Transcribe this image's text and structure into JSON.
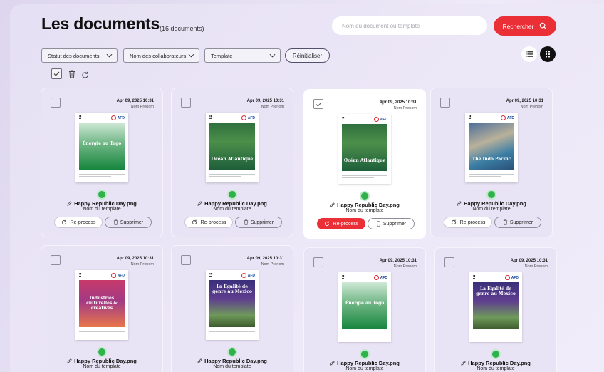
{
  "header": {
    "title": "Les documents",
    "count": "(16 documents)",
    "search_placeholder": "Nom du document ou template",
    "search_button": "Rechercher"
  },
  "filters": {
    "status": "Statut des documents",
    "collaborators": "Nom des collaborateurs",
    "template": "Template",
    "reset": "Réinitialiser"
  },
  "view": {
    "active": "grid"
  },
  "colors": {
    "accent": "#ea2f36",
    "status_ok": "#2fb14c"
  },
  "documents": [
    {
      "date": "Apr 09, 2025 10:31",
      "author": "Nom Prenom",
      "file": "Happy Republic Day.png",
      "template": "Nom du template",
      "thumb_title": "Énergie au Togo",
      "theme": "green",
      "selected": false,
      "reprocess": "Re-process",
      "delete": "Supprimer",
      "reprocess_active": false
    },
    {
      "date": "Apr 09, 2025 10:31",
      "author": "Nom Prenom",
      "file": "Happy Republic Day.png",
      "template": "Nom du template",
      "thumb_title": "Océan Atlantique",
      "theme": "forest",
      "selected": false,
      "reprocess": "Re-process",
      "delete": "Supprimer",
      "reprocess_active": false
    },
    {
      "date": "Apr 09, 2025 10:31",
      "author": "Nom Prenom",
      "file": "Happy Republic Day.png",
      "template": "Nom du template",
      "thumb_title": "Océan Atlantique",
      "theme": "forest",
      "selected": true,
      "reprocess": "Re-process",
      "delete": "Supprimer",
      "reprocess_active": true
    },
    {
      "date": "Apr 09, 2025 10:31",
      "author": "Nom Prenom",
      "file": "Happy Republic Day.png",
      "template": "Nom du template",
      "thumb_title": "The Indo Pacific",
      "theme": "ocean",
      "selected": false,
      "reprocess": "Re-process",
      "delete": "Supprimer",
      "reprocess_active": false
    },
    {
      "date": "Apr 09, 2025 10:31",
      "author": "Nom Prenom",
      "file": "Happy Republic Day.png",
      "template": "Nom du template",
      "thumb_title": "Industries culturelles & créatives",
      "theme": "sunset",
      "selected": false
    },
    {
      "date": "Apr 09, 2025 10:31",
      "author": "Nom Prenom",
      "file": "Happy Republic Day.png",
      "template": "Nom du template",
      "thumb_title": "La Égalité de genre au Mexico",
      "theme": "purple",
      "selected": false
    },
    {
      "date": "Apr 09, 2025 10:31",
      "author": "Nom Prenom",
      "file": "Happy Republic Day.png",
      "template": "Nom du template",
      "thumb_title": "Énergie au Togo",
      "theme": "green",
      "selected": false
    },
    {
      "date": "Apr 09, 2025 10:31",
      "author": "Nom Prenom",
      "file": "Happy Republic Day.png",
      "template": "Nom du template",
      "thumb_title": "La Égalité de genre au Mexico",
      "theme": "purple",
      "selected": false
    }
  ]
}
